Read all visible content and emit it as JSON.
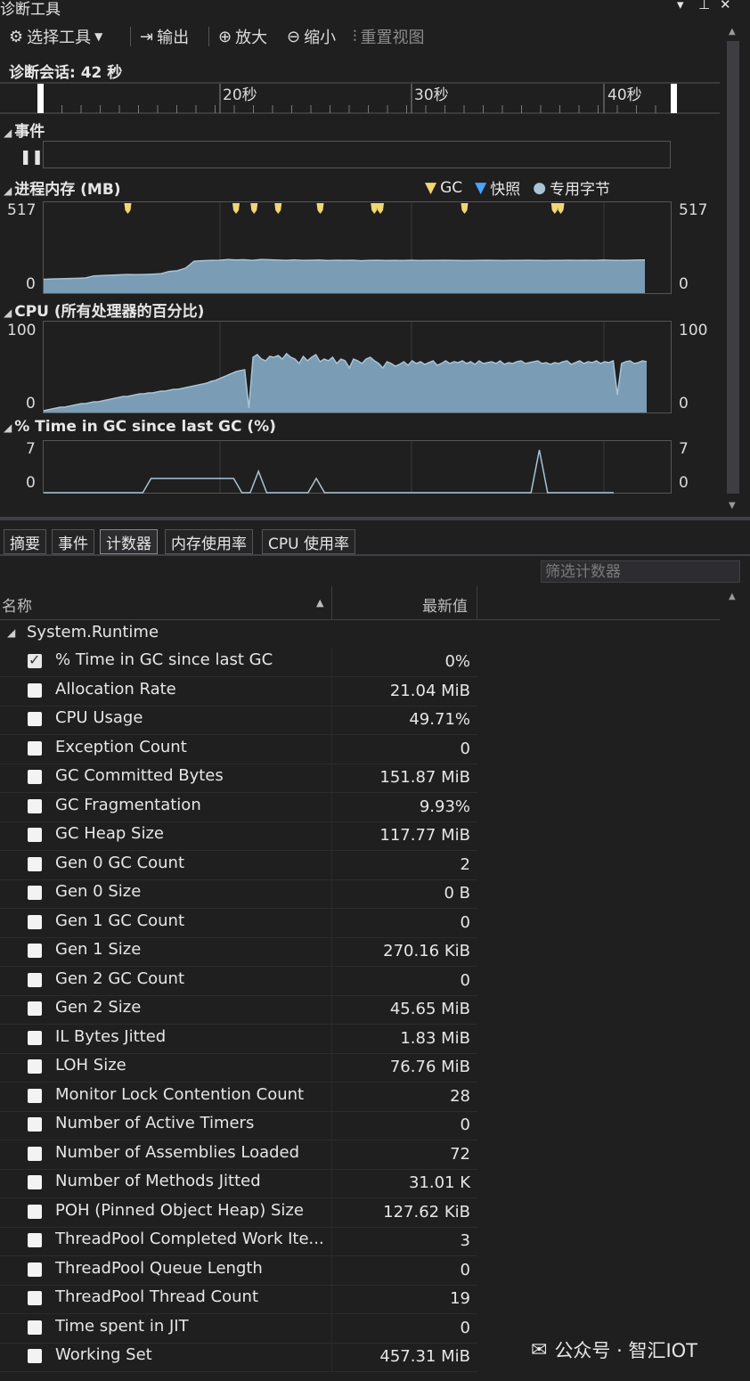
{
  "window": {
    "title": "诊断工具"
  },
  "toolbar": {
    "select_tool": "选择工具",
    "output": "输出",
    "zoom_in": "放大",
    "zoom_out": "缩小",
    "reset_view": "重置视图"
  },
  "session": {
    "label": "诊断会话: 42 秒"
  },
  "timeline": {
    "ticks": [
      "20秒",
      "30秒",
      "40秒"
    ]
  },
  "sections": {
    "events": "事件",
    "memory": "进程内存 (MB)",
    "cpu": "CPU (所有处理器的百分比)",
    "gc": "% Time in GC since last GC (%)"
  },
  "memory_legend": {
    "gc": "GC",
    "snapshot": "快照",
    "private": "专用字节"
  },
  "chart_data": [
    {
      "type": "area",
      "title": "进程内存 (MB)",
      "ylim": [
        0,
        517
      ],
      "y_tick_labels": [
        "517",
        "0"
      ],
      "series": [
        {
          "name": "专用字节",
          "values": [
            80,
            82,
            83,
            85,
            86,
            88,
            100,
            102,
            104,
            106,
            108,
            107,
            108,
            110,
            112,
            125,
            130,
            145,
            185,
            188,
            190,
            191,
            195,
            193,
            194,
            190,
            195,
            194,
            192,
            190,
            193,
            190,
            191,
            192,
            189,
            191,
            190,
            191,
            188,
            190,
            191,
            189,
            190,
            189,
            191,
            189,
            190,
            190,
            191,
            190,
            189,
            189,
            190,
            191,
            190,
            189,
            190,
            190,
            191,
            190,
            189,
            190,
            190,
            191,
            190,
            191,
            190,
            192,
            191,
            190,
            191,
            192,
            193
          ]
        }
      ],
      "gc_markers": [
        0.14,
        0.32,
        0.35,
        0.39,
        0.46,
        0.55,
        0.56,
        0.7,
        0.85,
        0.86
      ]
    },
    {
      "type": "area",
      "title": "CPU (所有处理器的百分比)",
      "ylim": [
        0,
        100
      ],
      "y_tick_labels": [
        "100",
        "0"
      ],
      "series": [
        {
          "name": "CPU",
          "values": [
            2,
            3,
            4,
            5,
            6,
            6,
            7,
            8,
            9,
            10,
            10,
            11,
            12,
            12,
            13,
            14,
            15,
            16,
            17,
            18,
            18,
            19,
            20,
            21,
            21,
            22,
            22,
            23,
            24,
            24,
            25,
            26,
            26,
            27,
            28,
            29,
            30,
            31,
            32,
            33,
            35,
            36,
            38,
            40,
            42,
            44,
            46,
            47,
            48,
            5,
            62,
            65,
            60,
            58,
            63,
            62,
            64,
            60,
            66,
            62,
            60,
            55,
            63,
            58,
            62,
            65,
            57,
            60,
            58,
            62,
            55,
            60,
            58,
            50,
            60,
            58,
            55,
            60,
            62,
            58,
            55,
            50,
            57,
            55,
            52,
            54,
            57,
            53,
            58,
            55,
            57,
            54,
            56,
            58,
            53,
            55,
            58,
            55,
            57,
            56,
            58,
            55,
            57,
            54,
            58,
            55,
            56,
            57,
            55,
            58,
            54,
            56,
            55,
            57,
            58,
            55,
            56,
            57,
            58,
            55,
            56,
            54,
            56,
            55,
            57,
            58,
            54,
            56,
            58,
            55,
            57,
            56,
            58,
            55,
            57,
            56,
            58,
            20,
            55,
            57,
            58,
            55,
            56,
            58,
            57
          ]
        }
      ]
    },
    {
      "type": "line",
      "title": "% Time in GC since last GC (%)",
      "ylim": [
        0,
        7
      ],
      "y_tick_labels": [
        "7",
        "0"
      ],
      "series": [
        {
          "name": "% Time in GC since last GC",
          "values": [
            0,
            0,
            0,
            0,
            0,
            0,
            0,
            0,
            0,
            0,
            0,
            0,
            0,
            2,
            2,
            2,
            2,
            2,
            2,
            2,
            2,
            2,
            2,
            2,
            0,
            0,
            3,
            0,
            0,
            0,
            0,
            0,
            0,
            2,
            0,
            0,
            0,
            0,
            0,
            0,
            0,
            0,
            0,
            0,
            0,
            0,
            0,
            0,
            0,
            0,
            0,
            0,
            0,
            0,
            0,
            0,
            0,
            0,
            0,
            0,
            6,
            0,
            0,
            0,
            0,
            0,
            0,
            0,
            0,
            0
          ]
        }
      ]
    }
  ],
  "tabs": [
    {
      "label": "摘要",
      "active": false
    },
    {
      "label": "事件",
      "active": false
    },
    {
      "label": "计数器",
      "active": true
    },
    {
      "label": "内存使用率",
      "active": false
    },
    {
      "label": "CPU 使用率",
      "active": false
    }
  ],
  "filter": {
    "placeholder": "筛选计数器"
  },
  "grid": {
    "col_name": "名称",
    "col_value": "最新值",
    "group": "System.Runtime",
    "rows": [
      {
        "name": "% Time in GC since last GC",
        "value": "0%",
        "checked": true
      },
      {
        "name": "Allocation Rate",
        "value": "21.04 MiB",
        "checked": false
      },
      {
        "name": "CPU Usage",
        "value": "49.71%",
        "checked": false
      },
      {
        "name": "Exception Count",
        "value": "0",
        "checked": false
      },
      {
        "name": "GC Committed Bytes",
        "value": "151.87 MiB",
        "checked": false
      },
      {
        "name": "GC Fragmentation",
        "value": "9.93%",
        "checked": false
      },
      {
        "name": "GC Heap Size",
        "value": "117.77 MiB",
        "checked": false
      },
      {
        "name": "Gen 0 GC Count",
        "value": "2",
        "checked": false
      },
      {
        "name": "Gen 0 Size",
        "value": "0 B",
        "checked": false
      },
      {
        "name": "Gen 1 GC Count",
        "value": "0",
        "checked": false
      },
      {
        "name": "Gen 1 Size",
        "value": "270.16 KiB",
        "checked": false
      },
      {
        "name": "Gen 2 GC Count",
        "value": "0",
        "checked": false
      },
      {
        "name": "Gen 2 Size",
        "value": "45.65 MiB",
        "checked": false
      },
      {
        "name": "IL Bytes Jitted",
        "value": "1.83 MiB",
        "checked": false
      },
      {
        "name": "LOH Size",
        "value": "76.76 MiB",
        "checked": false
      },
      {
        "name": "Monitor Lock Contention Count",
        "value": "28",
        "checked": false
      },
      {
        "name": "Number of Active Timers",
        "value": "0",
        "checked": false
      },
      {
        "name": "Number of Assemblies Loaded",
        "value": "72",
        "checked": false
      },
      {
        "name": "Number of Methods Jitted",
        "value": "31.01 K",
        "checked": false
      },
      {
        "name": "POH (Pinned Object Heap) Size",
        "value": "127.62 KiB",
        "checked": false
      },
      {
        "name": "ThreadPool Completed Work Ite...",
        "value": "3",
        "checked": false
      },
      {
        "name": "ThreadPool Queue Length",
        "value": "0",
        "checked": false
      },
      {
        "name": "ThreadPool Thread Count",
        "value": "19",
        "checked": false
      },
      {
        "name": "Time spent in JIT",
        "value": "0",
        "checked": false
      },
      {
        "name": "Working Set",
        "value": "457.31 MiB",
        "checked": false
      }
    ]
  },
  "watermark": {
    "text": "公众号 · 智汇IOT"
  },
  "colors": {
    "chart_fill": "#7a9cb4",
    "chart_stroke": "#a9c4d6",
    "gc_marker": "#f2d675",
    "snapshot": "#4aa3ff",
    "background": "#1f1f1f"
  }
}
